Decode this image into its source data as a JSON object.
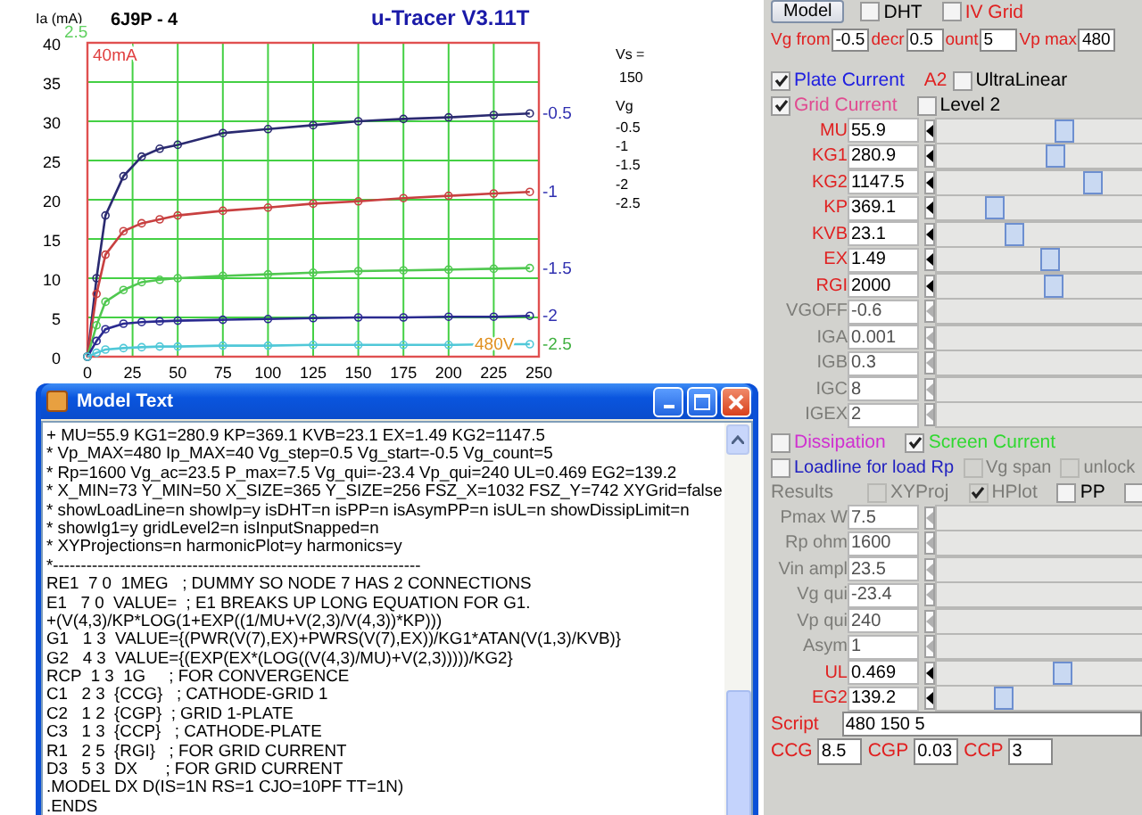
{
  "app": {
    "title": "u-Tracer V3.11T"
  },
  "chart": {
    "chart_data": {
      "type": "line",
      "title": "6J9P - 4",
      "ylabel": "Ia (mA)",
      "x": [
        0,
        5,
        10,
        20,
        30,
        40,
        50,
        75,
        100,
        125,
        150,
        175,
        200,
        225,
        245
      ],
      "series": [
        {
          "name": "-0.5",
          "color": "#2a2a70",
          "values": [
            0,
            10,
            18,
            23,
            25.5,
            26.5,
            27,
            28.5,
            29,
            29.5,
            30,
            30.3,
            30.5,
            30.8,
            31
          ]
        },
        {
          "name": "-1",
          "color": "#c84040",
          "values": [
            0,
            8,
            13,
            16,
            17,
            17.5,
            18,
            18.6,
            19,
            19.5,
            19.8,
            20.2,
            20.5,
            20.8,
            21
          ]
        },
        {
          "name": "-1.5",
          "color": "#50c850",
          "values": [
            0,
            4,
            7,
            8.5,
            9.5,
            9.8,
            10,
            10.3,
            10.5,
            10.7,
            10.9,
            11,
            11.1,
            11.2,
            11.3
          ]
        },
        {
          "name": "-2",
          "color": "#2a2a90",
          "values": [
            0,
            2,
            3.5,
            4.2,
            4.4,
            4.5,
            4.6,
            4.7,
            4.8,
            4.9,
            5,
            5,
            5.1,
            5.1,
            5.2
          ]
        },
        {
          "name": "-2.5",
          "color": "#50c8d8",
          "values": [
            0,
            0.5,
            0.9,
            1.1,
            1.2,
            1.3,
            1.3,
            1.4,
            1.4,
            1.5,
            1.5,
            1.5,
            1.5,
            1.6,
            1.6
          ]
        }
      ],
      "xlim": [
        0,
        250
      ],
      "ylim": [
        0,
        40
      ],
      "xticks": [
        0,
        25,
        50,
        75,
        100,
        125,
        150,
        175,
        200,
        225,
        250
      ],
      "yticks": [
        0,
        5,
        10,
        15,
        20,
        25,
        30,
        35,
        40
      ],
      "grid": true,
      "annotations": [
        "2.5",
        "40mA",
        "480V"
      ]
    },
    "end_labels": [
      {
        "text": "-0.5",
        "color": "#3030b0"
      },
      {
        "text": "-1",
        "color": "#3030b0"
      },
      {
        "text": "-1.5",
        "color": "#3030b0"
      },
      {
        "text": "-2",
        "color": "#3030b0"
      },
      {
        "text": "-2.5",
        "color": "#40b040"
      }
    ]
  },
  "legend": {
    "vs_label": "Vs =",
    "vs_value": "150",
    "vg_label": "Vg"
  },
  "model_window": {
    "title": "Model Text",
    "lines": [
      "+ MU=55.9 KG1=280.9 KP=369.1 KVB=23.1 EX=1.49 KG2=1147.5",
      "* Vp_MAX=480 Ip_MAX=40 Vg_step=0.5 Vg_start=-0.5 Vg_count=5",
      "* Rp=1600 Vg_ac=23.5 P_max=7.5 Vg_qui=-23.4 Vp_qui=240 UL=0.469 EG2=139.2",
      "* X_MIN=73 Y_MIN=50 X_SIZE=365 Y_SIZE=256 FSZ_X=1032 FSZ_Y=742 XYGrid=false",
      "* showLoadLine=n showIp=y isDHT=n isPP=n isAsymPP=n isUL=n showDissipLimit=n",
      "* showIg1=y gridLevel2=n isInputSnapped=n",
      "* XYProjections=n harmonicPlot=y harmonics=y",
      "*------------------------------------------------------------------",
      "RE1  7 0  1MEG   ; DUMMY SO NODE 7 HAS 2 CONNECTIONS",
      "E1   7 0  VALUE=  ; E1 BREAKS UP LONG EQUATION FOR G1.",
      "+(V(4,3)/KP*LOG(1+EXP((1/MU+V(2,3)/V(4,3))*KP)))",
      "G1   1 3  VALUE={(PWR(V(7),EX)+PWRS(V(7),EX))/KG1*ATAN(V(1,3)/KVB)}",
      "G2   4 3  VALUE={(EXP(EX*(LOG((V(4,3)/MU)+V(2,3)))))/KG2}",
      "RCP  1 3  1G     ; FOR CONVERGENCE",
      "C1   2 3  {CCG}   ; CATHODE-GRID 1",
      "C2   1 2  {CGP}  ; GRID 1-PLATE",
      "C3   1 3  {CCP}   ; CATHODE-PLATE",
      "R1   2 5  {RGI}   ; FOR GRID CURRENT",
      "D3   5 3  DX      ; FOR GRID CURRENT",
      ".MODEL DX D(IS=1N RS=1 CJO=10PF TT=1N)",
      ".ENDS"
    ]
  },
  "panel": {
    "rows": [
      {
        "kind": "bar",
        "items": [
          {
            "kind": "button",
            "label": "Model"
          },
          {
            "kind": "checkbox",
            "label": "DHT",
            "checked": false,
            "disabled": false,
            "color": "#000000"
          },
          {
            "kind": "checkbox",
            "label": "IV Grid",
            "checked": false,
            "disabled": false,
            "color": "#e02020"
          }
        ]
      },
      {
        "kind": "bar",
        "items": [
          {
            "kind": "label",
            "text": "Vg from",
            "color": "#e02020",
            "disabled": false
          },
          {
            "kind": "field",
            "value": "-0.5"
          },
          {
            "kind": "label",
            "text": "decr",
            "color": "#e02020",
            "disabled": false
          },
          {
            "kind": "field",
            "value": "0.5"
          },
          {
            "kind": "label",
            "text": "ount",
            "color": "#e02020",
            "disabled": false
          },
          {
            "kind": "field",
            "value": "5"
          },
          {
            "kind": "label",
            "text": "Vp max",
            "color": "#e02020",
            "disabled": false
          },
          {
            "kind": "field",
            "value": "480"
          }
        ]
      },
      {
        "kind": "bar",
        "items": [
          {
            "kind": "checkbox",
            "label": "Plate Current",
            "checked": true,
            "disabled": false,
            "color": "#2020e0"
          },
          {
            "kind": "label",
            "text": "A2",
            "color": "#e02020",
            "disabled": false
          },
          {
            "kind": "checkbox",
            "label": "UltraLinear",
            "checked": false,
            "disabled": false,
            "color": "#000000"
          }
        ]
      },
      {
        "kind": "bar",
        "items": [
          {
            "kind": "checkbox",
            "label": "Grid Current",
            "checked": true,
            "disabled": false,
            "color": "#e04a90"
          },
          {
            "kind": "checkbox",
            "label": "Level 2",
            "checked": false,
            "disabled": false,
            "color": "#000000"
          }
        ]
      },
      {
        "kind": "slider",
        "label": "MU",
        "value": "55.9",
        "level": 0.42,
        "disabled": false
      },
      {
        "kind": "slider",
        "label": "KG1",
        "value": "280.9",
        "level": 0.39,
        "disabled": false
      },
      {
        "kind": "slider",
        "label": "KG2",
        "value": "1147.5",
        "level": 0.51,
        "disabled": false
      },
      {
        "kind": "slider",
        "label": "KP",
        "value": "369.1",
        "level": 0.19,
        "disabled": false
      },
      {
        "kind": "slider",
        "label": "KVB",
        "value": "23.1",
        "level": 0.25,
        "disabled": false
      },
      {
        "kind": "slider",
        "label": "EX",
        "value": "1.49",
        "level": 0.37,
        "disabled": false
      },
      {
        "kind": "slider",
        "label": "RGI",
        "value": "2000",
        "level": 0.38,
        "disabled": false
      },
      {
        "kind": "slider",
        "label": "VGOFF",
        "value": "-0.6",
        "disabled": true
      },
      {
        "kind": "slider",
        "label": "IGA",
        "value": "0.001",
        "disabled": true
      },
      {
        "kind": "slider",
        "label": "IGB",
        "value": "0.3",
        "disabled": true
      },
      {
        "kind": "slider",
        "label": "IGC",
        "value": "8",
        "disabled": true
      },
      {
        "kind": "slider",
        "label": "IGEX",
        "value": "2",
        "disabled": true
      },
      {
        "kind": "bar",
        "items": [
          {
            "kind": "checkbox",
            "label": "Dissipation",
            "checked": false,
            "disabled": false,
            "color": "#d030d0"
          },
          {
            "kind": "checkbox",
            "label": "Screen Current",
            "checked": true,
            "disabled": false,
            "color": "#30d830"
          }
        ]
      },
      {
        "kind": "bar",
        "items": [
          {
            "kind": "checkbox",
            "label": "Loadline for load Rp",
            "checked": false,
            "disabled": false,
            "color": "#2020c0"
          },
          {
            "kind": "checkbox",
            "label": "Vg span",
            "checked": false,
            "disabled": true
          },
          {
            "kind": "checkbox",
            "label": "unlock",
            "checked": false,
            "disabled": true
          }
        ]
      },
      {
        "kind": "bar",
        "items": [
          {
            "kind": "label",
            "text": "Results",
            "disabled": true
          },
          {
            "kind": "checkbox",
            "label": "XYProj",
            "checked": false,
            "disabled": true
          },
          {
            "kind": "checkbox",
            "label": "HPlot",
            "checked": true,
            "disabled": true
          },
          {
            "kind": "checkbox",
            "label": "PP",
            "checked": false,
            "disabled": false,
            "color": "#000000"
          },
          {
            "kind": "checkbox",
            "checked": false,
            "disabled": false
          }
        ]
      },
      {
        "kind": "slider",
        "label": "Pmax W",
        "value": "7.5",
        "disabled": true
      },
      {
        "kind": "slider",
        "label": "Rp ohm",
        "value": "1600",
        "disabled": true
      },
      {
        "kind": "slider",
        "label": "Vin ampl",
        "value": "23.5",
        "disabled": true
      },
      {
        "kind": "slider",
        "label": "Vg qui",
        "value": "-23.4",
        "disabled": true
      },
      {
        "kind": "slider",
        "label": "Vp qui",
        "value": "240",
        "disabled": true
      },
      {
        "kind": "slider",
        "label": "Asym",
        "value": "1",
        "disabled": true
      },
      {
        "kind": "slider",
        "label": "UL",
        "value": "0.469",
        "level": 0.41,
        "disabled": false
      },
      {
        "kind": "slider",
        "label": "EG2",
        "value": "139.2",
        "level": 0.22,
        "disabled": false
      },
      {
        "kind": "bar",
        "items": [
          {
            "kind": "label",
            "text": "Script",
            "color": "#e02020",
            "disabled": false
          },
          {
            "kind": "long_field",
            "value": "480 150 5"
          }
        ]
      },
      {
        "kind": "bar",
        "items": [
          {
            "kind": "label",
            "text": "CCG",
            "color": "#e02020",
            "disabled": false
          },
          {
            "kind": "field",
            "value": "8.5"
          },
          {
            "kind": "label",
            "text": "CGP",
            "color": "#e02020",
            "disabled": false
          },
          {
            "kind": "field",
            "value": "0.03"
          },
          {
            "kind": "label",
            "text": "CCP",
            "color": "#e02020",
            "disabled": false
          },
          {
            "kind": "field",
            "value": "3"
          }
        ]
      }
    ]
  }
}
